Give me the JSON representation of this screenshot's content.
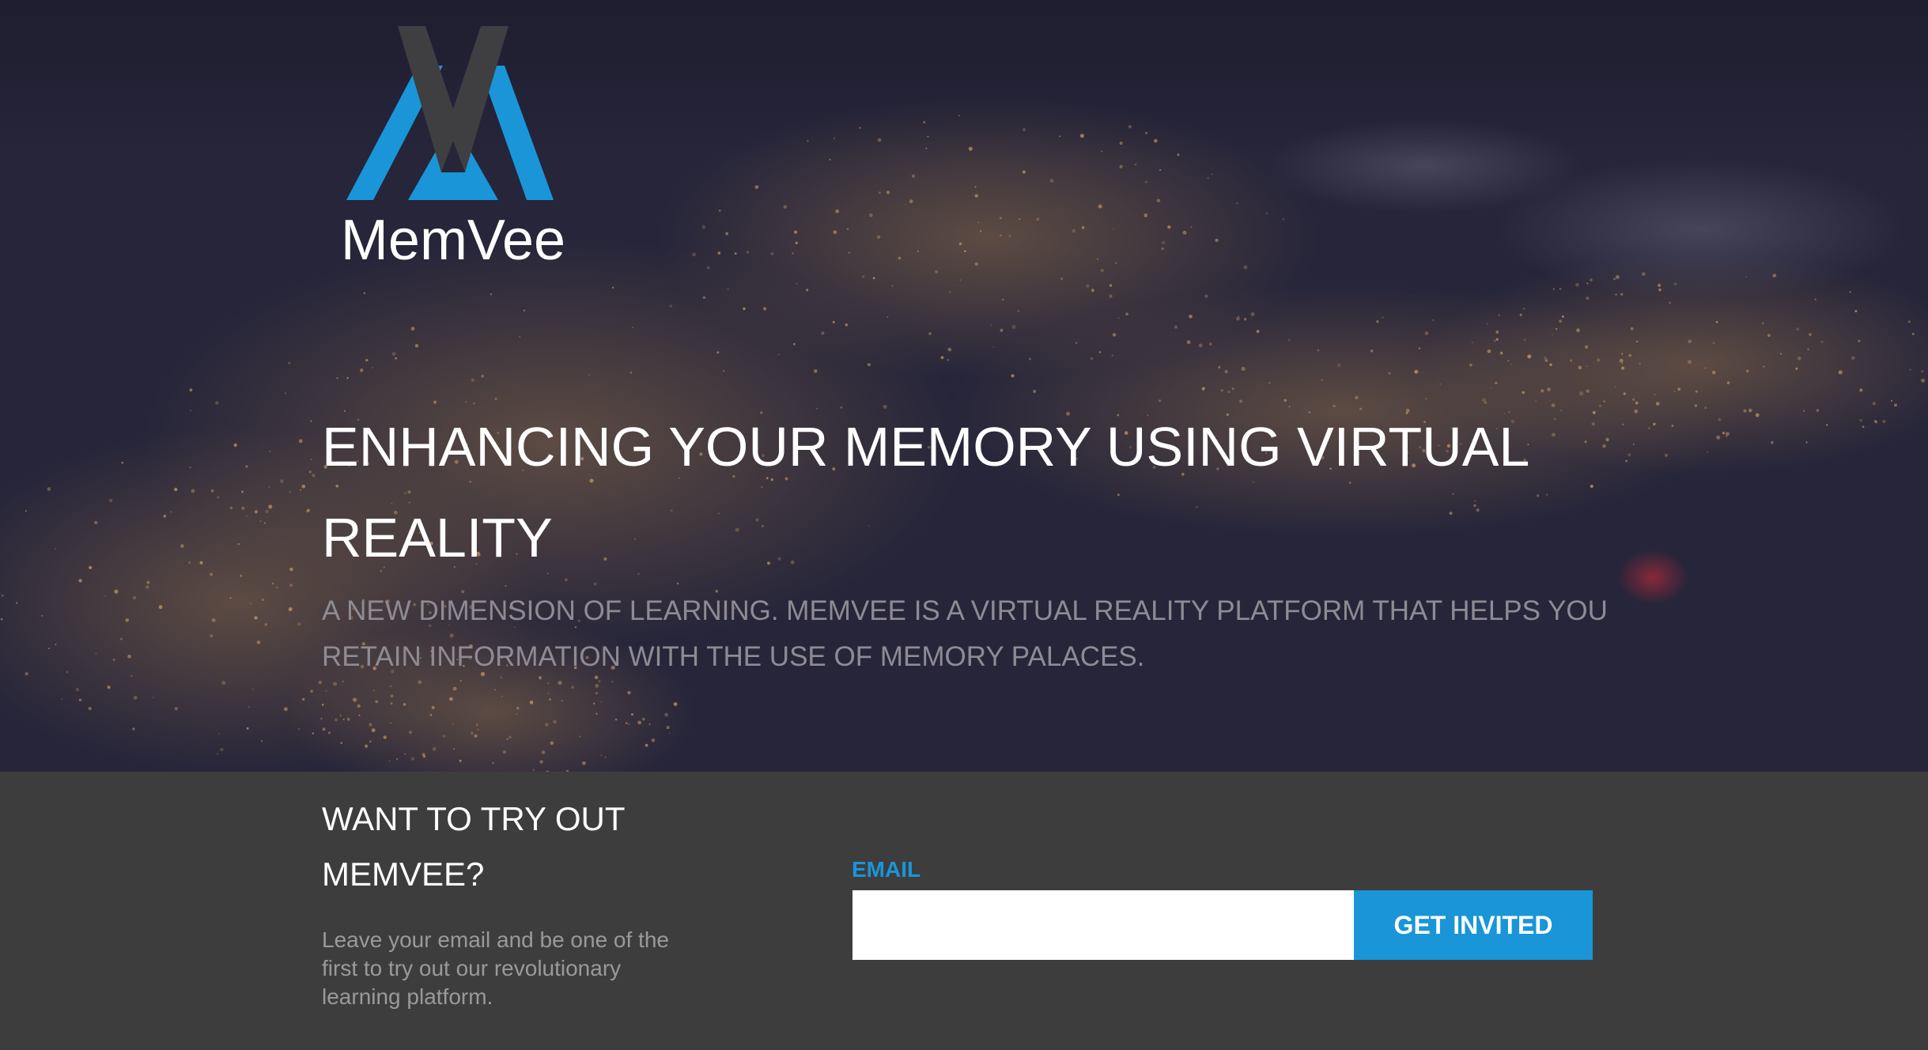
{
  "brand": {
    "name": "MemVee",
    "logo_icon": "memvee-logo-icon",
    "logo_colors": {
      "blue": "#1a95d8",
      "dark": "#3d3d3d"
    }
  },
  "hero": {
    "headline": "ENHANCING YOUR MEMORY USING VIRTUAL REALITY",
    "subline": "A NEW DIMENSION OF LEARNING. MEMVEE IS A VIRTUAL REALITY PLATFORM THAT HELPS YOU RETAIN INFORMATION WITH THE USE OF MEMORY PALACES.",
    "background": "earth-at-night-image"
  },
  "signup": {
    "title": "WANT TO TRY OUT MEMVEE?",
    "description": "Leave your email and be one of the first to try out our revolutionary learning platform.",
    "email_label": "EMAIL",
    "email_value": "",
    "email_placeholder": "",
    "button_label": "GET INVITED",
    "accent_color": "#1a95d8",
    "section_color": "#3d3d3e"
  }
}
